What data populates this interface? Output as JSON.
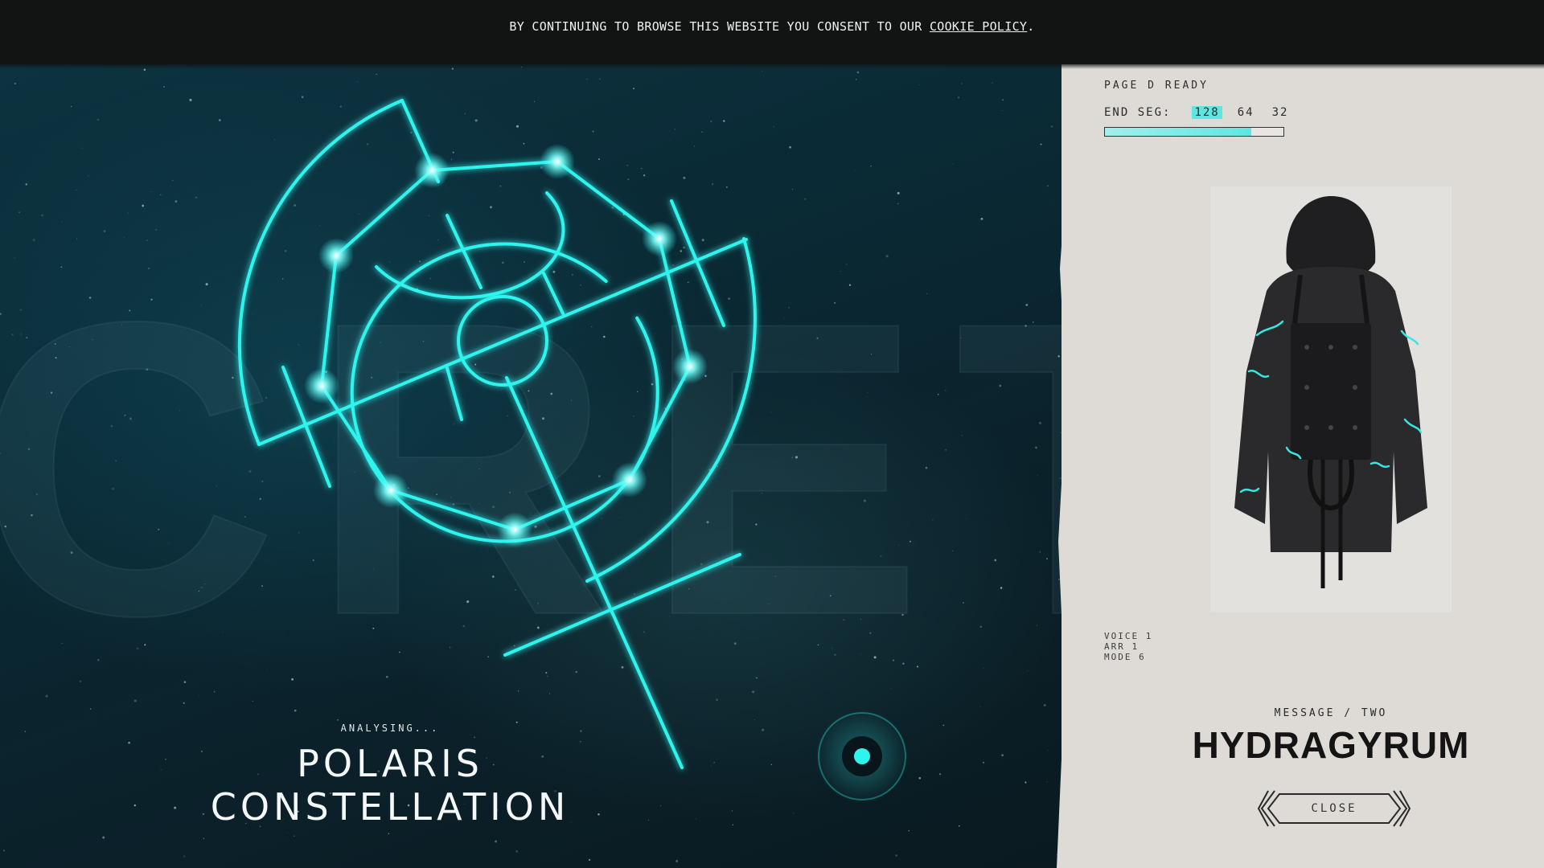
{
  "cookie": {
    "text": "BY CONTINUING TO BROWSE THIS WEBSITE YOU CONSENT TO OUR ",
    "link": "COOKIE POLICY",
    "end": "."
  },
  "scene": {
    "bg_word": "CRETA",
    "analysing": "ANALYSING...",
    "title_line1": "POLARIS",
    "title_line2": "CONSTELLATION",
    "accent": "#2ff4ee"
  },
  "panel": {
    "status": "PAGE D READY",
    "seg_label": "END SEG:",
    "seg_options": [
      "128",
      "64",
      "32"
    ],
    "seg_selected": "128",
    "seg_progress": 0.82,
    "meta": [
      "VOICE 1",
      "ARR 1",
      "MODE 6"
    ],
    "message_label": "MESSAGE / TWO",
    "product_title": "HYDRAGYRUM",
    "close_label": "CLOSE"
  }
}
